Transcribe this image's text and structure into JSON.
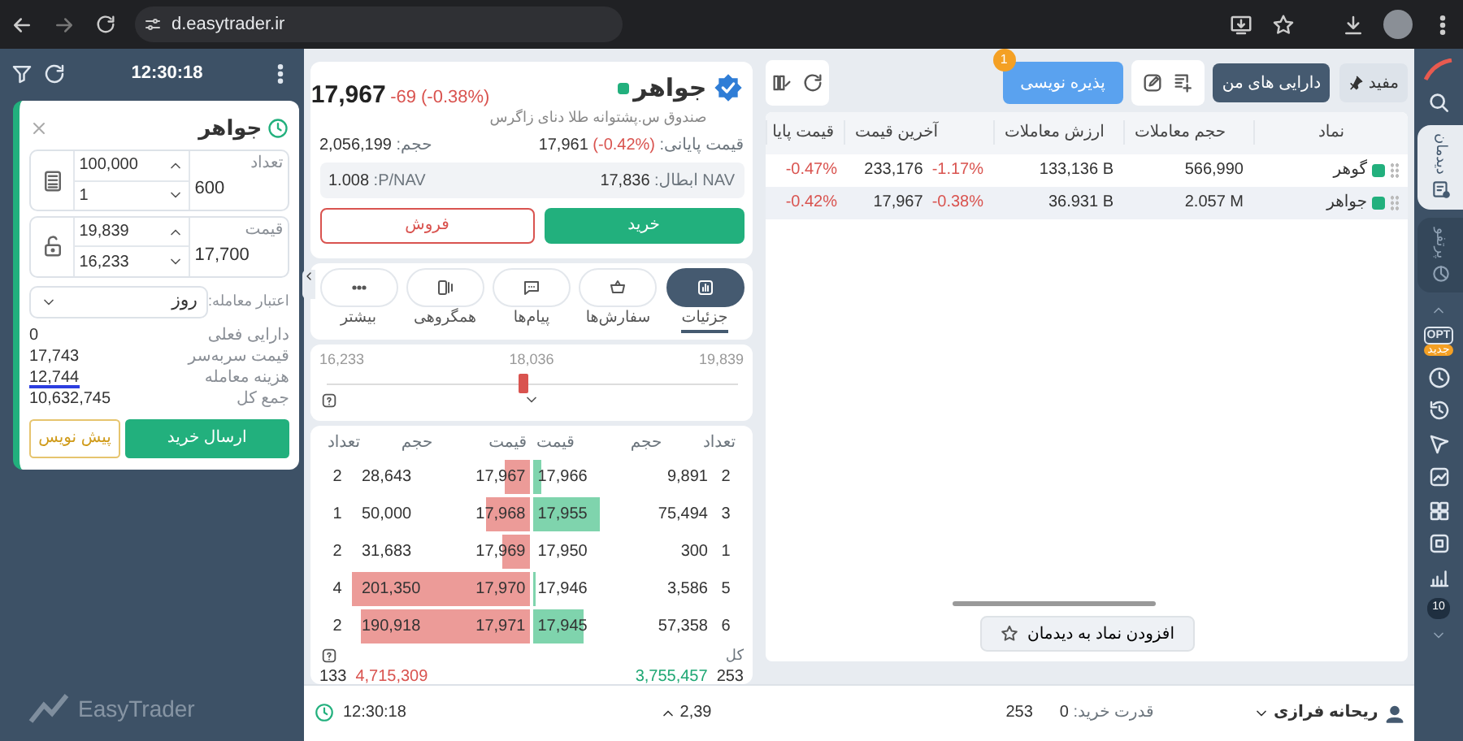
{
  "browser": {
    "url": "d.easytrader.ir"
  },
  "order_panel": {
    "time": "12:30:18",
    "symbol": "جواهر",
    "inputs": [
      {
        "label": "تعداد",
        "value": "600",
        "upper": "100,000",
        "lower": "1",
        "kind": "quantity"
      },
      {
        "label": "قیمت",
        "value": "17,700",
        "upper": "19,839",
        "lower": "16,233",
        "kind": "price"
      }
    ],
    "validity": {
      "label": "اعتبار معامله:",
      "value": "روز"
    },
    "summary": [
      {
        "label": "دارایی فعلی",
        "value": "0"
      },
      {
        "label": "قیمت سربه‌سر",
        "value": "17,743"
      },
      {
        "label": "هزینه معامله",
        "value": "12,744"
      },
      {
        "label": "جمع کل",
        "value": "10,632,745"
      }
    ],
    "buttons": [
      {
        "label": "ارسال خرید",
        "kind": "send"
      },
      {
        "label": "پیش نویس",
        "kind": "draft"
      }
    ]
  },
  "brand": "EasyTrader",
  "symbol_card": {
    "name": "جواهر",
    "description": "صندوق س.پشتوانه طلا دنای زاگرس",
    "price": "17,967",
    "change": "-69 (-0.38%)",
    "final_label": "قیمت پایانی:",
    "final_price": "17,961",
    "final_change": "(-0.42%)",
    "volume_label": "حجم:",
    "volume": "2,056,199",
    "nav_label": "NAV ابطال:",
    "nav": "17,836",
    "pnav_label": "P/NAV:",
    "pnav": "1.008",
    "buy": "خرید",
    "sell": "فروش"
  },
  "tabs": [
    {
      "label": "جزئیات",
      "selected": true
    },
    {
      "label": "سفارش‌ها",
      "selected": false
    },
    {
      "label": "پیام‌ها",
      "selected": false
    },
    {
      "label": "همگروهی",
      "selected": false
    },
    {
      "label": "بیشتر",
      "selected": false
    }
  ],
  "price_range": {
    "low": "16,233",
    "mid": "18,036",
    "high": "19,839",
    "level": 0.47
  },
  "order_book": {
    "columns": [
      "تعداد",
      "حجم",
      "قیمت",
      "قیمت",
      "حجم",
      "تعداد"
    ],
    "rows": [
      {
        "sell": {
          "count": "2",
          "volume": "28,643",
          "price": "17,967"
        },
        "buy": {
          "price": "17,966",
          "volume": "9,891",
          "count": "2"
        }
      },
      {
        "sell": {
          "count": "1",
          "volume": "50,000",
          "price": "17,968"
        },
        "buy": {
          "price": "17,955",
          "volume": "75,494",
          "count": "3"
        }
      },
      {
        "sell": {
          "count": "2",
          "volume": "31,683",
          "price": "17,969"
        },
        "buy": {
          "price": "17,950",
          "volume": "300",
          "count": "1"
        }
      },
      {
        "sell": {
          "count": "4",
          "volume": "201,350",
          "price": "17,970"
        },
        "buy": {
          "price": "17,946",
          "volume": "3,586",
          "count": "5"
        }
      },
      {
        "sell": {
          "count": "2",
          "volume": "190,918",
          "price": "17,971"
        },
        "buy": {
          "price": "17,945",
          "volume": "57,358",
          "count": "6"
        }
      }
    ],
    "total_label": "کل",
    "sell_total": {
      "count": "133",
      "volume": "4,715,309"
    },
    "buy_total": {
      "volume": "3,755,457",
      "count": "253"
    }
  },
  "watchlist": {
    "filters": [
      {
        "label": "مفید",
        "selected": false
      },
      {
        "label": "دارایی های من",
        "selected": true
      }
    ],
    "subscription": {
      "label": "پذیره نویسی",
      "badge": "1"
    },
    "columns": [
      "نماد",
      "حجم معاملات",
      "ارزش معاملات",
      "آخرین قیمت",
      "قیمت پایا"
    ],
    "rows": [
      {
        "symbol": "گوهر",
        "color": "#22b07d",
        "volume": "566,990",
        "value": "133,136 B",
        "last_price": "233,176",
        "last_change": "-1.17%",
        "final_change": "-0.47%",
        "selected": false
      },
      {
        "symbol": "جواهر",
        "color": "#22b07d",
        "volume": "2.057 M",
        "value": "36.931 B",
        "last_price": "17,967",
        "last_change": "-0.38%",
        "final_change": "-0.42%",
        "selected": true
      }
    ],
    "add_button": "افزودن نماد به دیدمان"
  },
  "sidebar": {
    "tabs": [
      {
        "label": "دیدمان",
        "selected": true
      },
      {
        "label": "پرتفو",
        "selected": false
      }
    ],
    "opt_label": "OPT",
    "new_badge": "جدید",
    "count_badge": "10"
  },
  "status_bar": {
    "time": "12:30:18",
    "ticker": "2,39",
    "other": "253",
    "power_label": "قدرت خرید:",
    "power": "0",
    "user": "ریحانه فرازی"
  }
}
